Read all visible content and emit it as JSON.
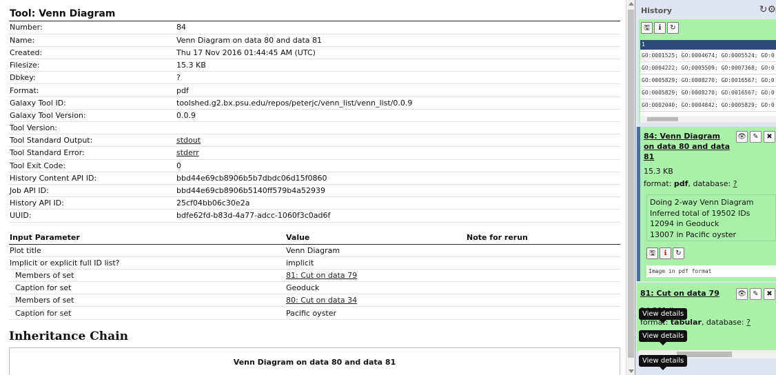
{
  "main": {
    "title": "Tool: Venn Diagram",
    "info": [
      {
        "key": "Number:",
        "value": "84",
        "link": false
      },
      {
        "key": "Name:",
        "value": "Venn Diagram on data 80 and data 81",
        "link": false
      },
      {
        "key": "Created:",
        "value": "Thu 17 Nov 2016 01:44:45 AM (UTC)",
        "link": false
      },
      {
        "key": "Filesize:",
        "value": "15.3 KB",
        "link": false
      },
      {
        "key": "Dbkey:",
        "value": "?",
        "link": false
      },
      {
        "key": "Format:",
        "value": "pdf",
        "link": false
      },
      {
        "key": "Galaxy Tool ID:",
        "value": "toolshed.g2.bx.psu.edu/repos/peterjc/venn_list/venn_list/0.0.9",
        "link": false
      },
      {
        "key": "Galaxy Tool Version:",
        "value": "0.0.9",
        "link": false
      },
      {
        "key": "Tool Version:",
        "value": "",
        "link": false
      },
      {
        "key": "Tool Standard Output:",
        "value": "stdout",
        "link": true
      },
      {
        "key": "Tool Standard Error:",
        "value": "stderr",
        "link": true
      },
      {
        "key": "Tool Exit Code:",
        "value": "0",
        "link": false
      },
      {
        "key": "History Content API ID:",
        "value": "bbd44e69cb8906b5b7dbdc06d15f0860",
        "link": false
      },
      {
        "key": "Job API ID:",
        "value": "bbd44e69cb8906b5140ff579b4a52939",
        "link": false
      },
      {
        "key": "History API ID:",
        "value": "25cf04bb06c30e2a",
        "link": false
      },
      {
        "key": "UUID:",
        "value": "bdfe62fd-b83d-4a77-adcc-1060f3c0ad6f",
        "link": false
      }
    ],
    "params_headers": [
      "Input Parameter",
      "Value",
      "Note for rerun"
    ],
    "params": [
      {
        "name": "Plot title",
        "value": "Venn Diagram",
        "link": false,
        "indent": false
      },
      {
        "name": "Implicit or explicit full ID list?",
        "value": "implicit",
        "link": false,
        "indent": false
      },
      {
        "name": "Members of set",
        "value": "81: Cut on data 79",
        "link": true,
        "indent": true
      },
      {
        "name": "Caption for set",
        "value": "Geoduck",
        "link": false,
        "indent": true
      },
      {
        "name": "Members of set",
        "value": "80: Cut on data 34",
        "link": true,
        "indent": true
      },
      {
        "name": "Caption for set",
        "value": "Pacific oyster",
        "link": false,
        "indent": true
      }
    ],
    "inheritance_title": "Inheritance Chain",
    "inheritance_item": "Venn Diagram on data 80 and data 81"
  },
  "history": {
    "title": "History",
    "peek_header": "1",
    "peek_rows": [
      "GO:0001525; GO:0004674; GO:0005524; GO:0",
      "GO:0004222; GO:0005509; GO:0007368; GO:0",
      "GO:0005829; GO:0008270; GO:0016567; GO:0",
      "GO:0005829; GO:0008270; GO:0016567; GO:0",
      "GO:0002040; GO:0004842; GO:0005829; GO:0"
    ],
    "ds84": {
      "title": "84: Venn Diagram on data 80 and data 81",
      "size": "15.3 KB",
      "format_label": "format:",
      "format": "pdf",
      "database_label": ", database:",
      "database": "?",
      "info_lines": [
        "Doing 2-way Venn Diagram",
        "Inferred total of 19502 IDs",
        "12094 in Geoduck",
        "13007 in Pacific oyster"
      ],
      "note": "Image in pdf format"
    },
    "ds81": {
      "title": "81: Cut on data 79",
      "size": "24,581 lines",
      "format_label": "format:",
      "format": "tabular",
      "database_label": ", database:",
      "database": "?"
    },
    "tooltip": "View details"
  }
}
